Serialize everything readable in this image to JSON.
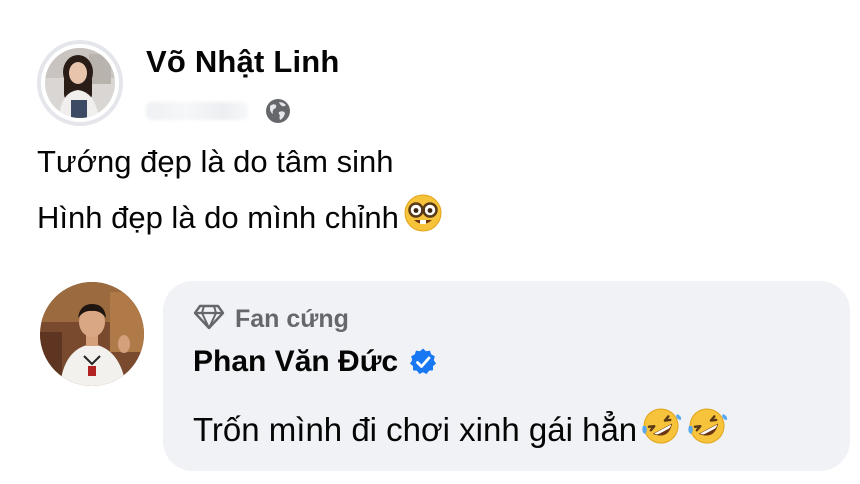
{
  "post": {
    "author_name": "Võ Nhật Linh",
    "privacy_icon": "globe-icon",
    "lines": [
      "Tướng đẹp là do tâm sinh",
      "Hình đẹp là do mình chỉnh"
    ],
    "line2_emoji": "nerd-face-icon"
  },
  "comment": {
    "badge_icon": "diamond-icon",
    "badge_label": "Fan cứng",
    "author_name": "Phan Văn Đức",
    "verified_icon": "verified-badge-icon",
    "text": "Trốn mình đi chơi xinh gái hẳn",
    "emojis": [
      "rofl-icon",
      "rofl-icon"
    ]
  },
  "colors": {
    "text_primary": "#050505",
    "text_secondary": "#65676b",
    "bubble_bg": "#f0f2f5",
    "verified_blue": "#1877f2",
    "avatar_ring": "#e4e6eb"
  }
}
